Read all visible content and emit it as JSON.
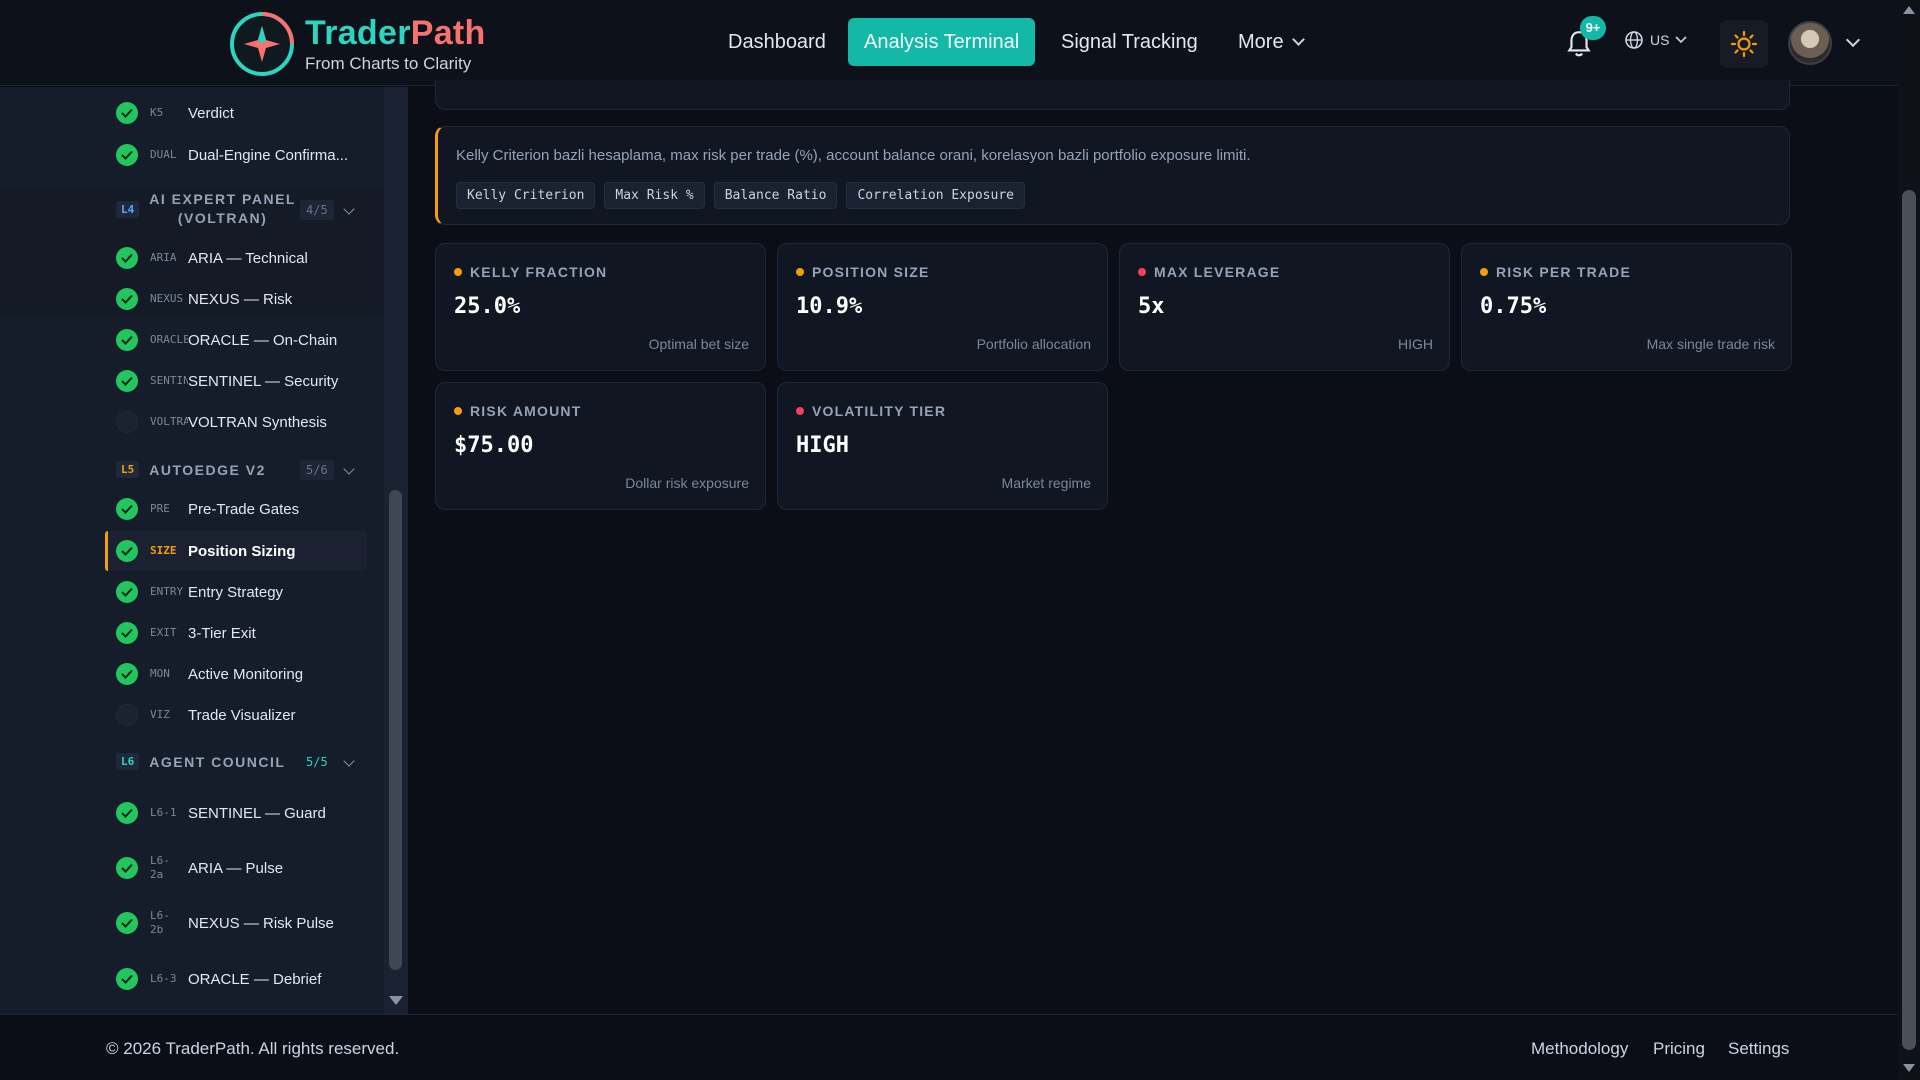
{
  "brand": {
    "name_part1": "Trader",
    "name_part2": "Path",
    "tagline": "From Charts to Clarity"
  },
  "nav": [
    {
      "label": "Dashboard"
    },
    {
      "label": "Analysis Terminal"
    },
    {
      "label": "Signal Tracking"
    },
    {
      "label": "More"
    }
  ],
  "header": {
    "notifications_badge": "9+",
    "language": "US",
    "icons": [
      "bell-icon",
      "globe-icon",
      "sun-icon",
      "avatar"
    ]
  },
  "sidebar": {
    "top_items": [
      {
        "code": "K5",
        "label": "Verdict"
      },
      {
        "code": "DUAL",
        "label": "Dual-Engine Confirma..."
      }
    ],
    "sections": [
      {
        "level": "L4",
        "title_line1": "AI EXPERT PANEL",
        "title_line2": "(VOLTRAN)",
        "count": "4/5",
        "items": [
          {
            "code": "ARIA",
            "label": "ARIA — Technical",
            "done": true
          },
          {
            "code": "NEXUS",
            "label": "NEXUS — Risk",
            "done": true
          },
          {
            "code": "ORACLE",
            "label": "ORACLE — On-Chain",
            "done": true
          },
          {
            "code": "SENTINEL",
            "label": "SENTINEL — Security",
            "done": true
          },
          {
            "code": "VOLTRAN",
            "label": "VOLTRAN Synthesis",
            "done": false
          }
        ]
      },
      {
        "level": "L5",
        "title": "AUTOEDGE V2",
        "count": "5/6",
        "items": [
          {
            "code": "PRE",
            "label": "Pre-Trade Gates",
            "done": true
          },
          {
            "code": "SIZE",
            "label": "Position Sizing",
            "done": true,
            "active": true
          },
          {
            "code": "ENTRY",
            "label": "Entry Strategy",
            "done": true
          },
          {
            "code": "EXIT",
            "label": "3-Tier Exit",
            "done": true
          },
          {
            "code": "MON",
            "label": "Active Monitoring",
            "done": true
          },
          {
            "code": "VIZ",
            "label": "Trade Visualizer",
            "done": false
          }
        ]
      },
      {
        "level": "L6",
        "title": "AGENT COUNCIL",
        "count": "5/5",
        "items": [
          {
            "code": "L6-1",
            "label": "SENTINEL — Guard",
            "done": true
          },
          {
            "code": "L6-2a",
            "label": "ARIA — Pulse",
            "done": true
          },
          {
            "code": "L6-2b",
            "label": "NEXUS — Risk Pulse",
            "done": true
          },
          {
            "code": "L6-3",
            "label": "ORACLE — Debrief",
            "done": true
          }
        ]
      }
    ]
  },
  "main": {
    "description": "Kelly Criterion bazli hesaplama, max risk per trade (%), account balance orani, korelasyon bazli portfolio exposure limiti.",
    "tags": [
      "Kelly Criterion",
      "Max Risk %",
      "Balance Ratio",
      "Correlation Exposure"
    ],
    "metrics": [
      {
        "label": "KELLY FRACTION",
        "value": "25.0%",
        "sub": "Optimal bet size",
        "dot": "#f59e0b"
      },
      {
        "label": "POSITION SIZE",
        "value": "10.9%",
        "sub": "Portfolio allocation",
        "dot": "#f59e0b"
      },
      {
        "label": "MAX LEVERAGE",
        "value": "5x",
        "sub": "HIGH",
        "dot": "#f43f5e"
      },
      {
        "label": "RISK PER TRADE",
        "value": "0.75%",
        "sub": "Max single trade risk",
        "dot": "#f59e0b"
      },
      {
        "label": "RISK AMOUNT",
        "value": "$75.00",
        "sub": "Dollar risk exposure",
        "dot": "#f59e0b"
      },
      {
        "label": "VOLATILITY TIER",
        "value": "HIGH",
        "sub": "Market regime",
        "dot": "#f43f5e"
      }
    ]
  },
  "footer": {
    "copyright": "© 2026 TraderPath. All rights reserved.",
    "links": [
      "Methodology",
      "Pricing",
      "Settings"
    ]
  },
  "colors": {
    "accent_teal": "#14b8a6",
    "accent_orange": "#f59e0b",
    "alert_red": "#f43f5e",
    "success_green": "#22c55e",
    "background": "#0b0e17"
  }
}
